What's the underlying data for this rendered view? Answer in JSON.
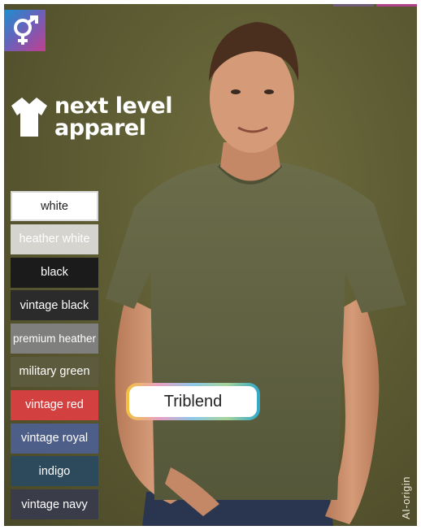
{
  "brand": {
    "line1": "next level",
    "line2": "apparel"
  },
  "colors": [
    {
      "label": "white",
      "bg": "#ffffff",
      "fg": "#1d1d1d"
    },
    {
      "label": "heather white",
      "bg": "#d6d4cf",
      "fg": "#f5f5f3"
    },
    {
      "label": "black",
      "bg": "#1b1b1b",
      "fg": "#ffffff"
    },
    {
      "label": "vintage black",
      "bg": "#2b2b2b",
      "fg": "#ffffff"
    },
    {
      "label": "premium heather",
      "bg": "#7f7f7d",
      "fg": "#ffffff"
    },
    {
      "label": "military green",
      "bg": "#5d5b3e",
      "fg": "#ffffff"
    },
    {
      "label": "vintage red",
      "bg": "#d24040",
      "fg": "#ffffff"
    },
    {
      "label": "vintage royal",
      "bg": "#4d5e88",
      "fg": "#ffffff"
    },
    {
      "label": "indigo",
      "bg": "#2d4a5c",
      "fg": "#ffffff"
    },
    {
      "label": "vintage navy",
      "bg": "#3a3c4a",
      "fg": "#ffffff"
    }
  ],
  "badge": {
    "label": "Triblend"
  },
  "watermark": "AI-origin",
  "icons": {
    "gender": "male-female-symbol-icon",
    "logo": "t-shirt-icon"
  }
}
